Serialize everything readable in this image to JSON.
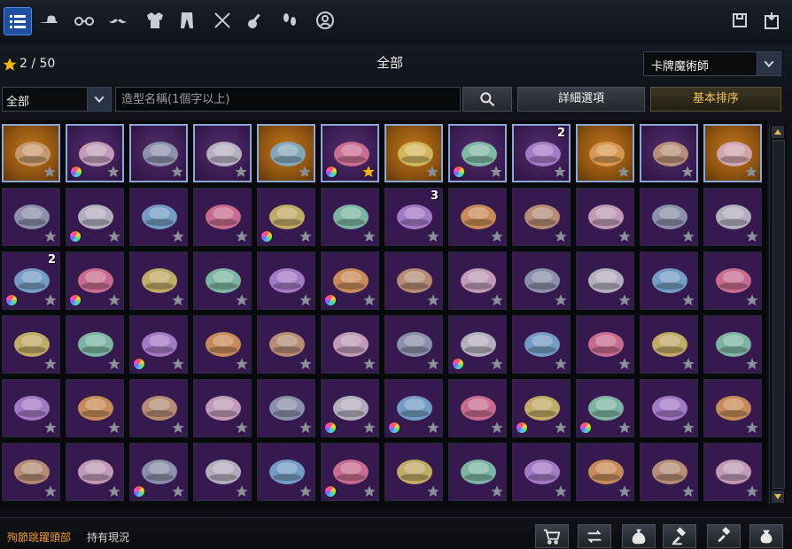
{
  "top_bar": {
    "categories": [
      {
        "name": "all-list-icon",
        "active": true
      },
      {
        "name": "hat-icon"
      },
      {
        "name": "glasses-icon"
      },
      {
        "name": "mustache-icon"
      },
      {
        "name": "jacket-icon"
      },
      {
        "name": "pants-icon"
      },
      {
        "name": "crossed-swords-icon"
      },
      {
        "name": "guitar-icon"
      },
      {
        "name": "footprints-icon"
      },
      {
        "name": "face-circle-icon"
      }
    ],
    "right_icons": [
      "outfit-save-icon",
      "outfit-load-icon"
    ]
  },
  "header": {
    "favorites": "2 / 50",
    "title": "全部",
    "class_selector": "卡牌魔術師"
  },
  "filter": {
    "category": "全部",
    "search_placeholder": "造型名稱(1個字以上)",
    "detail_button": "詳細選項",
    "sort_button": "基本排序"
  },
  "grid": {
    "rows": [
      [
        {
          "icon": "wings-icon",
          "tint": "orange",
          "owned": true
        },
        {
          "icon": "bow-hairpin-icon",
          "tint": "purple",
          "owned": true,
          "dye": true
        },
        {
          "icon": "round-glasses-icon",
          "tint": "purple",
          "owned": true
        },
        {
          "icon": "heart-glasses-icon",
          "tint": "purple",
          "owned": true
        },
        {
          "icon": "armor-suit-icon",
          "tint": "orange",
          "owned": true
        },
        {
          "icon": "uniform-icon",
          "tint": "purple",
          "owned": true,
          "dye": true,
          "star": "gold"
        },
        {
          "icon": "underwear-icon",
          "tint": "orange",
          "owned": true
        },
        {
          "icon": "stockings-icon",
          "tint": "purple",
          "owned": true,
          "dye": true
        },
        {
          "icon": "lace-ribbon-icon",
          "tint": "purple",
          "owned": true,
          "qty": "2"
        },
        {
          "icon": "ornate-crown-icon",
          "tint": "orange",
          "owned": true
        },
        {
          "icon": "ring-halo-icon",
          "tint": "purple",
          "owned": true
        },
        {
          "icon": "gold-flower-icon",
          "tint": "orange",
          "owned": true
        }
      ],
      [
        {
          "icon": "aviator-helmet-icon"
        },
        {
          "icon": "black-bow-icon",
          "dye": true
        },
        {
          "icon": "feather-pin-icon"
        },
        {
          "icon": "witch-hat-icon"
        },
        {
          "icon": "bunny-head-icon",
          "dye": true
        },
        {
          "icon": "hood-icon"
        },
        {
          "icon": "blue-bow-icon",
          "qty": "3"
        },
        {
          "icon": "brooch-bow-icon"
        },
        {
          "icon": "dark-helmet-icon"
        },
        {
          "icon": "maid-headband-icon"
        },
        {
          "icon": "chick-hat-icon"
        },
        {
          "icon": "frog-hat-icon"
        }
      ],
      [
        {
          "icon": "flower-veil-icon",
          "qty": "2",
          "dye": true
        },
        {
          "icon": "white-flower-veil-icon",
          "dye": true
        },
        {
          "icon": "blue-headband-icon"
        },
        {
          "icon": "sunglasses-icon"
        },
        {
          "icon": "silver-circlet-icon"
        },
        {
          "icon": "rose-pin-icon",
          "dye": true
        },
        {
          "icon": "bowler-hat-icon"
        },
        {
          "icon": "bunny-beanie-icon"
        },
        {
          "icon": "tiara-icon"
        },
        {
          "icon": "silver-tiara-icon"
        },
        {
          "icon": "veil-net-icon"
        },
        {
          "icon": "thorn-crown-icon"
        }
      ],
      [
        {
          "icon": "thin-circlet-icon"
        },
        {
          "icon": "dark-crown-icon"
        },
        {
          "icon": "ice-crown-icon",
          "dye": true
        },
        {
          "icon": "gold-crown-icon"
        },
        {
          "icon": "wing-ornament-icon"
        },
        {
          "icon": "red-hat-icon"
        },
        {
          "icon": "teal-hat-icon"
        },
        {
          "icon": "black-hat-icon",
          "dye": true
        },
        {
          "icon": "pink-cat-ears-icon"
        },
        {
          "icon": "beige-ears-icon"
        },
        {
          "icon": "hairpin-icon"
        },
        {
          "icon": "hairpin-pair-icon"
        }
      ],
      [
        {
          "icon": "blue-wig-icon"
        },
        {
          "icon": "pink-flower-bow-icon"
        },
        {
          "icon": "shades-icon"
        },
        {
          "icon": "skull-pins-icon"
        },
        {
          "icon": "fluffy-hat-icon"
        },
        {
          "icon": "box-cat-icon",
          "dye": true
        },
        {
          "icon": "tech-helmet-icon",
          "dye": true
        },
        {
          "icon": "blob-hat-icon"
        },
        {
          "icon": "rabbit-mask-icon",
          "dye": true
        },
        {
          "icon": "goat-mask-icon",
          "dye": true
        },
        {
          "icon": "sleepy-cat-icon"
        },
        {
          "icon": "white-cat-icon"
        }
      ],
      [
        {
          "icon": "black-cat-icon"
        },
        {
          "icon": "halo-icon"
        },
        {
          "icon": "shark-hat-icon",
          "dye": true
        },
        {
          "icon": "xmas-tree-hat-icon"
        },
        {
          "icon": "penguin-hat-icon"
        },
        {
          "icon": "red-bow-icon",
          "dye": true
        },
        {
          "icon": "cat-ear-band-icon"
        },
        {
          "icon": "mask-band-icon"
        },
        {
          "icon": "spiky-band-icon"
        },
        {
          "icon": "wolf-mask-icon"
        },
        {
          "icon": "visor-icon"
        },
        {
          "icon": "round-specs-icon"
        }
      ]
    ]
  },
  "footer": {
    "item_name": "殉節跳躍頭部",
    "status": "持有現況",
    "buttons": [
      "shopping-cart-icon",
      "trade-icon",
      "coin-bag-icon",
      "auction-hammer-icon",
      "gavel-icon",
      "lock-bag-icon"
    ]
  }
}
